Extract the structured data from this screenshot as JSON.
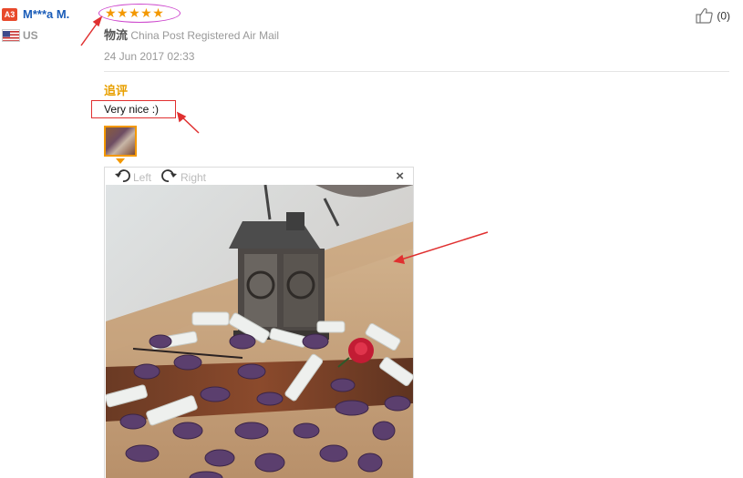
{
  "reviewer": {
    "level_badge": "A3",
    "name": "M***a M.",
    "country": "US",
    "rating": 5,
    "rating_stars": "★★★★★"
  },
  "helpful": {
    "count": "(0)",
    "icon": "thumbs-up-icon"
  },
  "shipping": {
    "label": "物流",
    "method": "China Post Registered Air Mail"
  },
  "review_date": "24 Jun 2017 02:33",
  "additional_review": {
    "heading": "追评",
    "text": "Very nice :)"
  },
  "image_viewer": {
    "rotate_left_label": "Left",
    "rotate_right_label": "Right",
    "close_label": "×"
  },
  "colors": {
    "username": "#1a5cb8",
    "stars": "#f39800",
    "heading": "#e8a000",
    "annotation": "#e03030",
    "star_highlight": "#cc44cc"
  }
}
